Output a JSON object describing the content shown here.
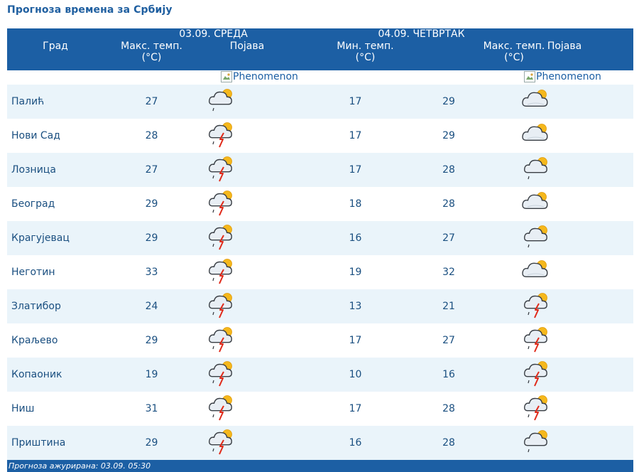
{
  "page": {
    "title": "Прогноза времена за Србију"
  },
  "header": {
    "day1": "03.09. СРЕДА",
    "day2": "04.09. ЧЕТВРТАК",
    "city": "Град",
    "max_temp_1": "Макс. темп. (°C)",
    "phenomenon_1": "Појава",
    "min_temp_2": "Мин. темп. (°C)",
    "max_temp_2": "Макс. темп. (°C)",
    "phenomenon_2": "Појава",
    "broken_image_alt_1": "Phenomenon",
    "broken_image_alt_2": "Phenomenon"
  },
  "rows": [
    {
      "city": "Палић",
      "max1": "27",
      "min2": "17",
      "max2": "29",
      "icon1": "cloud-sun-rain-icon",
      "icon2": "partly-cloudy-icon"
    },
    {
      "city": "Нови Сад",
      "max1": "28",
      "min2": "17",
      "max2": "29",
      "icon1": "thunderstorm-sun-icon",
      "icon2": "partly-cloudy-icon"
    },
    {
      "city": "Лозница",
      "max1": "27",
      "min2": "17",
      "max2": "28",
      "icon1": "thunderstorm-sun-icon",
      "icon2": "cloud-sun-rain-icon"
    },
    {
      "city": "Београд",
      "max1": "29",
      "min2": "18",
      "max2": "28",
      "icon1": "thunderstorm-sun-icon",
      "icon2": "partly-cloudy-icon"
    },
    {
      "city": "Крагујевац",
      "max1": "29",
      "min2": "16",
      "max2": "27",
      "icon1": "thunderstorm-sun-icon",
      "icon2": "cloud-sun-rain-icon"
    },
    {
      "city": "Неготин",
      "max1": "33",
      "min2": "19",
      "max2": "32",
      "icon1": "thunderstorm-sun-icon",
      "icon2": "partly-cloudy-icon"
    },
    {
      "city": "Златибор",
      "max1": "24",
      "min2": "13",
      "max2": "21",
      "icon1": "thunderstorm-sun-icon",
      "icon2": "thunderstorm-sun-icon"
    },
    {
      "city": "Краљево",
      "max1": "29",
      "min2": "17",
      "max2": "27",
      "icon1": "thunderstorm-sun-icon",
      "icon2": "thunderstorm-sun-icon"
    },
    {
      "city": "Копаоник",
      "max1": "19",
      "min2": "10",
      "max2": "16",
      "icon1": "thunderstorm-sun-icon",
      "icon2": "thunderstorm-sun-icon"
    },
    {
      "city": "Ниш",
      "max1": "31",
      "min2": "17",
      "max2": "28",
      "icon1": "thunderstorm-sun-icon",
      "icon2": "thunderstorm-sun-icon"
    },
    {
      "city": "Приштина",
      "max1": "29",
      "min2": "16",
      "max2": "28",
      "icon1": "thunderstorm-sun-icon",
      "icon2": "cloud-sun-rain-icon"
    }
  ],
  "footer": {
    "updated": "Прогноза ажурирана:  03.09. 05:30"
  },
  "colors": {
    "header_bg": "#1c5fa4",
    "row_tint": "#eaf4fa",
    "text": "#1a4f80",
    "title": "#1f5fa0"
  }
}
